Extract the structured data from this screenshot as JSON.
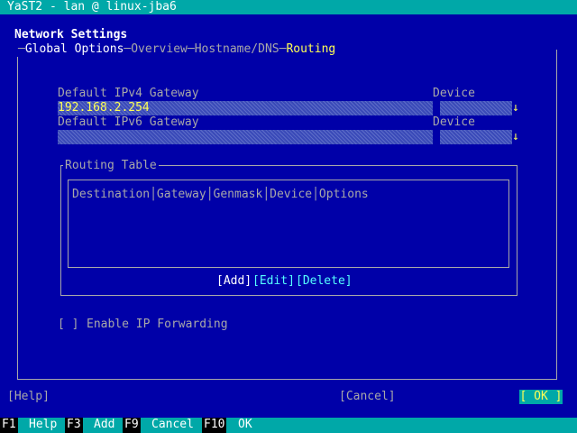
{
  "window": {
    "title": "YaST2 - lan @ linux-jba6"
  },
  "header": {
    "title": "Network Settings"
  },
  "tabs": [
    {
      "label": "Global Options",
      "hotkey": "G"
    },
    {
      "label": "Overview"
    },
    {
      "label": "Hostname/DNS"
    },
    {
      "label": "Routing",
      "active": true
    }
  ],
  "tab_separator": "─",
  "ipv4": {
    "label": "Default IPv4 Gateway",
    "value": "192.168.2.254",
    "device_label": "Device",
    "device_value": ""
  },
  "ipv6": {
    "label": "Default IPv6 Gateway",
    "value": "",
    "device_label": "Device",
    "device_value": ""
  },
  "dropdown_arrow": "↓",
  "routing_table": {
    "title": "Routing Table",
    "header_text": "Destination│Gateway│Genmask│Device│Options",
    "columns": [
      "Destination",
      "Gateway",
      "Genmask",
      "Device",
      "Options"
    ],
    "rows": [],
    "add_label": "[Add]",
    "edit_label": "[Edit]",
    "delete_label": "[Delete]"
  },
  "ip_forwarding": {
    "checkbox": "[ ]",
    "label": "Enable IP Forwarding",
    "checked": false
  },
  "buttons": {
    "help": "[Help]",
    "cancel": "[Cancel]",
    "ok": "[ OK ]"
  },
  "footer": [
    {
      "key": "F1",
      "label": "Help"
    },
    {
      "key": "F3",
      "label": "Add"
    },
    {
      "key": "F9",
      "label": "Cancel"
    },
    {
      "key": "F10",
      "label": "OK"
    }
  ],
  "colors": {
    "background": "#0000a8",
    "titlebar": "#00a8a8",
    "highlight": "#ffff55",
    "text": "#a8a8a8"
  }
}
